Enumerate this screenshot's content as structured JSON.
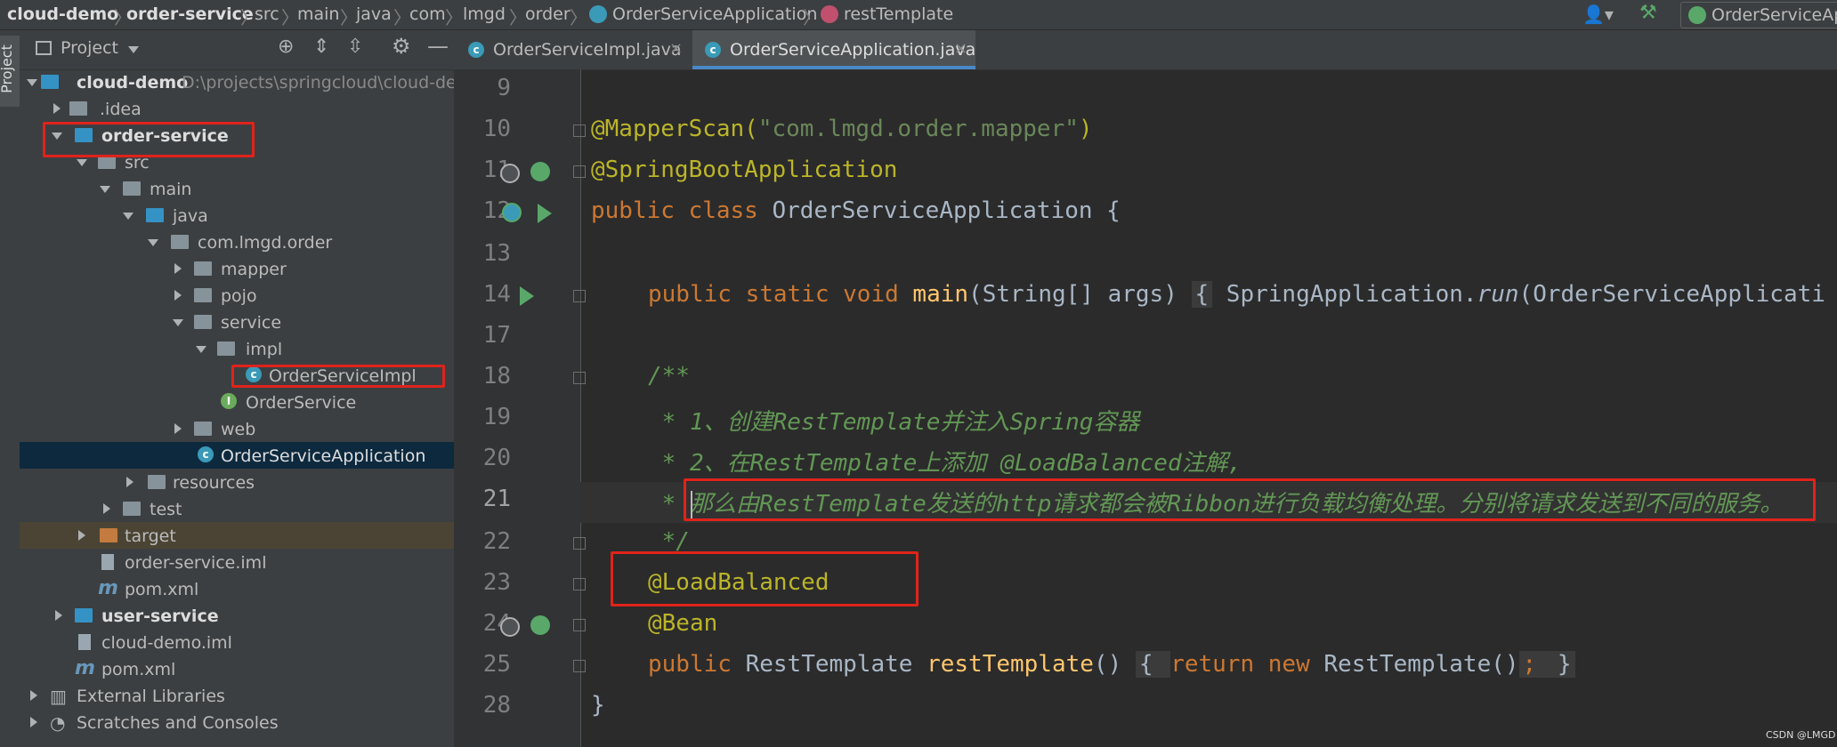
{
  "breadcrumb": [
    "cloud-demo",
    "order-service",
    "src",
    "main",
    "java",
    "com",
    "lmgd",
    "order",
    "OrderServiceApplication",
    "restTemplate"
  ],
  "run_config": "OrderServiceAp",
  "panel": {
    "title": "Project"
  },
  "tree": [
    {
      "label": "cloud-demo",
      "path": "D:\\projects\\springcloud\\cloud-dem"
    },
    {
      "label": ".idea"
    },
    {
      "label": "order-service"
    },
    {
      "label": "src"
    },
    {
      "label": "main"
    },
    {
      "label": "java"
    },
    {
      "label": "com.lmgd.order"
    },
    {
      "label": "mapper"
    },
    {
      "label": "pojo"
    },
    {
      "label": "service"
    },
    {
      "label": "impl"
    },
    {
      "label": "OrderServiceImpl"
    },
    {
      "label": "OrderService"
    },
    {
      "label": "web"
    },
    {
      "label": "OrderServiceApplication"
    },
    {
      "label": "resources"
    },
    {
      "label": "test"
    },
    {
      "label": "target"
    },
    {
      "label": "order-service.iml"
    },
    {
      "label": "pom.xml"
    },
    {
      "label": "user-service"
    },
    {
      "label": "cloud-demo.iml"
    },
    {
      "label": "pom.xml"
    },
    {
      "label": "External Libraries"
    },
    {
      "label": "Scratches and Consoles"
    }
  ],
  "tabs": [
    {
      "label": "OrderServiceImpl.java"
    },
    {
      "label": "OrderServiceApplication.java"
    }
  ],
  "line_numbers": [
    "9",
    "10",
    "11",
    "12",
    "13",
    "14",
    "17",
    "18",
    "19",
    "20",
    "21",
    "22",
    "23",
    "24",
    "25",
    "28"
  ],
  "code": {
    "l10_ann": "@MapperScan(",
    "l10_str": "\"com.lmgd.order.mapper\"",
    "l10_end": ")",
    "l11": "@SpringBootApplication",
    "l12_kw": "public class ",
    "l12_rest": "OrderServiceApplication {",
    "l14_kw": "public static void ",
    "l14_fn": "main",
    "l14_args": "(String[] args) ",
    "l14_fold": "{",
    "l14_rest": " SpringApplication.",
    "l14_run": "run",
    "l14_tail": "(OrderServiceApplicati",
    "l18": "/**",
    "l19": " * 1、创建RestTemplate并注入Spring容器",
    "l20": " * 2、在RestTemplate上添加 @LoadBalanced注解,",
    "l21_star": " * ",
    "l21": "那么由RestTemplate发送的http请求都会被Ribbon进行负载均衡处理。分别将请求发送到不同的服务。",
    "l22": " */",
    "l23": "@LoadBalanced",
    "l24": "@Bean",
    "l25_kw": "public ",
    "l25_type": "RestTemplate ",
    "l25_fn": "restTemplate",
    "l25_paren": "() ",
    "l25_fold": "{ ",
    "l25_ret": "return new ",
    "l25_tail": "RestTemplate()",
    "l25_semi": "; ",
    "l25_close": "}",
    "l28": "}"
  },
  "watermark": "CSDN @LMGD"
}
